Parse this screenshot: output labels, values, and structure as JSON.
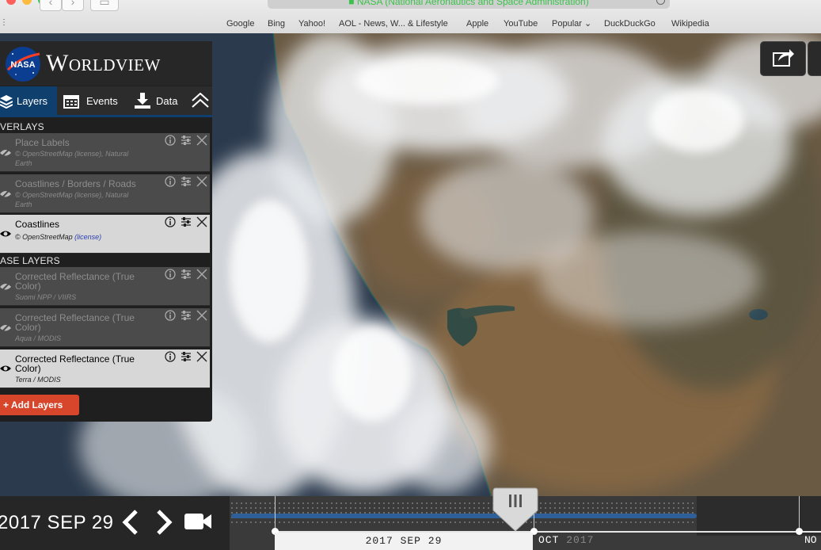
{
  "browser": {
    "url_title": "NASA (National Aeronautics and Space Administration)",
    "favorites": [
      "Google",
      "Bing",
      "Yahoo!",
      "AOL - News, W... & Lifestyle",
      "Apple",
      "YouTube",
      "Popular ⌄",
      "DuckDuckGo",
      "Wikipedia"
    ]
  },
  "app": {
    "title": "Worldview",
    "logo_text": "NASA"
  },
  "tabs": {
    "layers": "Layers",
    "events": "Events",
    "data": "Data"
  },
  "overlays": {
    "heading": "VERLAYS",
    "items": [
      {
        "name": "Place Labels",
        "source_prefix": "© OpenStreetMap (license), Natural",
        "source_cont": "Earth"
      },
      {
        "name": "Coastlines / Borders / Roads",
        "source_prefix": "© OpenStreetMap (license), Natural",
        "source_cont": "Earth"
      },
      {
        "name": "Coastlines",
        "source_prefix": "© OpenStreetMap ",
        "source_link": "(license)"
      }
    ]
  },
  "base_layers": {
    "heading": "ASE LAYERS",
    "items": [
      {
        "name": "Corrected Reflectance (True Color)",
        "source": "Suomi NPP / VIIRS"
      },
      {
        "name": "Corrected Reflectance (True Color)",
        "source": "Aqua / MODIS"
      },
      {
        "name": "Corrected Reflectance (True Color)",
        "source": "Terra / MODIS"
      }
    ]
  },
  "add_layers": "+ Add Layers",
  "timeline": {
    "date": "2017 SEP 29",
    "box_date": "2017 SEP 29",
    "next_month": "OCT ",
    "next_year": "2017",
    "edge_label": "NO"
  },
  "colors": {
    "accent": "#0f3f6d",
    "add_button": "#d7452b",
    "timeline_bar": "#2f5f98"
  }
}
